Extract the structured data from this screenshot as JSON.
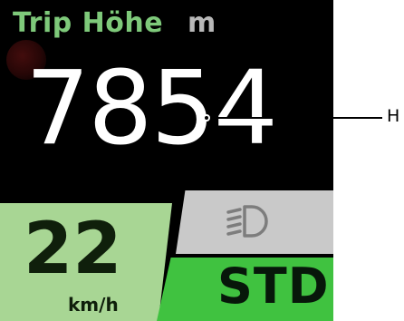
{
  "trip": {
    "title": "Trip Höhe",
    "unit": "m",
    "value": "7854"
  },
  "speed": {
    "value": "22",
    "unit": "km/h"
  },
  "light": {
    "icon": "headlight-icon"
  },
  "mode": {
    "value": "STD"
  },
  "callout": {
    "label": "H"
  },
  "colors": {
    "background": "#000000",
    "title_green": "#7ec97a",
    "speed_panel": "#a8d694",
    "mode_panel": "#40c240",
    "light_panel": "#c9c9c9"
  }
}
